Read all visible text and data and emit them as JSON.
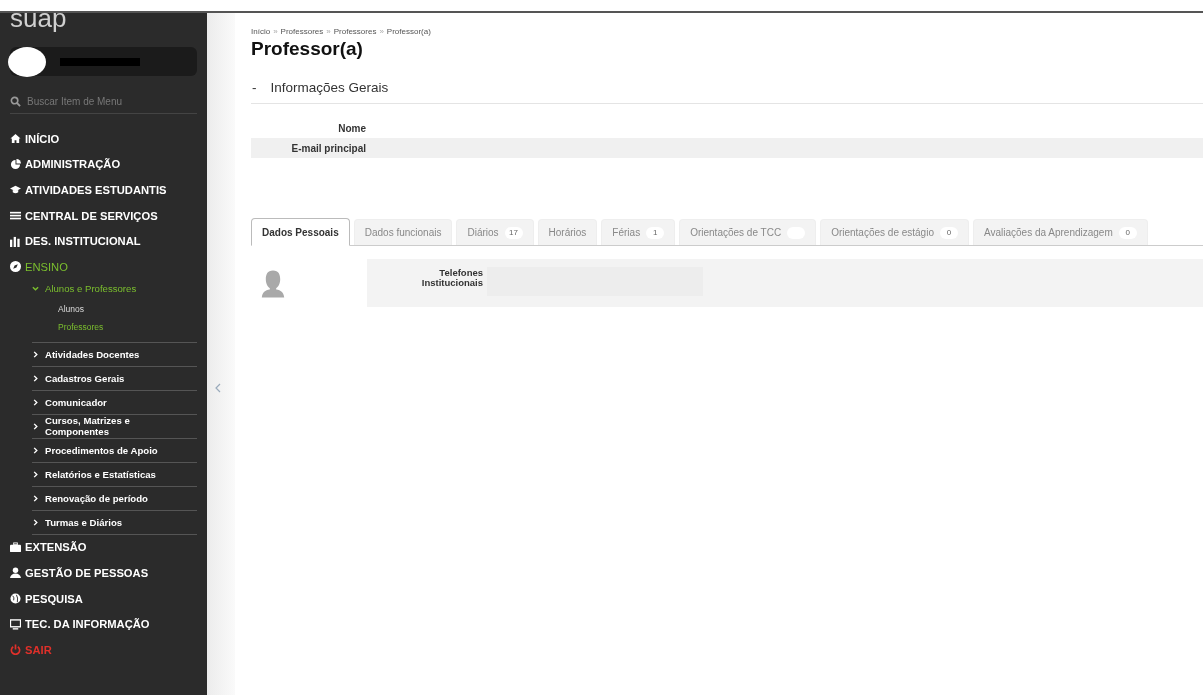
{
  "app": {
    "logo": "suap"
  },
  "sidebar": {
    "search": {
      "placeholder": "Buscar Item de Menu"
    },
    "items": [
      {
        "label": "INÍCIO",
        "kind": "menu",
        "selected": false
      },
      {
        "label": "ADMINISTRAÇÃO",
        "kind": "menu",
        "selected": false
      },
      {
        "label": "ATIVIDADES ESTUDANTIS",
        "kind": "menu",
        "selected": false
      },
      {
        "label": "CENTRAL DE SERVIÇOS",
        "kind": "menu",
        "selected": false
      },
      {
        "label": "DES. INSTITUCIONAL",
        "kind": "menu",
        "selected": false
      },
      {
        "label": "ENSINO",
        "kind": "menu",
        "selected": true,
        "children": [
          {
            "label": "Alunos e Professores",
            "expanded": true,
            "children": [
              {
                "label": "Alunos",
                "selected": false
              },
              {
                "label": "Professores",
                "selected": true
              }
            ]
          },
          {
            "label": "Atividades Docentes",
            "expanded": false
          },
          {
            "label": "Cadastros Gerais",
            "expanded": false
          },
          {
            "label": "Comunicador",
            "expanded": false
          },
          {
            "label": "Cursos, Matrizes e Componentes",
            "expanded": false
          },
          {
            "label": "Procedimentos de Apoio",
            "expanded": false
          },
          {
            "label": "Relatórios e Estatísticas",
            "expanded": false
          },
          {
            "label": "Renovação de período",
            "expanded": false
          },
          {
            "label": "Turmas e Diários",
            "expanded": false
          }
        ]
      },
      {
        "label": "EXTENSÃO",
        "kind": "menu",
        "selected": false
      },
      {
        "label": "GESTÃO DE PESSOAS",
        "kind": "menu",
        "selected": false
      },
      {
        "label": "PESQUISA",
        "kind": "menu",
        "selected": false
      },
      {
        "label": "TEC. DA INFORMAÇÃO",
        "kind": "menu",
        "selected": false
      },
      {
        "label": "SAIR",
        "kind": "logout",
        "selected": false
      }
    ]
  },
  "breadcrumb": [
    "Início",
    "Professores",
    "Professores",
    "Professor(a)"
  ],
  "breadcrumb_separator": "»",
  "title": "Professor(a)",
  "section": {
    "toggle": "-",
    "title": "Informações Gerais",
    "fields": [
      {
        "label": "Nome"
      },
      {
        "label": "E-mail principal"
      }
    ]
  },
  "tabs": [
    {
      "label": "Dados Pessoais",
      "selected": true,
      "badge": false
    },
    {
      "label": "Dados funcionais",
      "selected": false,
      "badge": false
    },
    {
      "label": "Diários",
      "selected": false,
      "badge": true,
      "count": "17"
    },
    {
      "label": "Horários",
      "selected": false,
      "badge": false
    },
    {
      "label": "Férias",
      "selected": false,
      "badge": true,
      "count": "1"
    },
    {
      "label": "Orientações de TCC",
      "selected": false,
      "badge": true
    },
    {
      "label": "Orientações de estágio",
      "selected": false,
      "badge": true,
      "count": "0"
    },
    {
      "label": "Avaliações da Aprendizagem",
      "selected": false,
      "badge": true,
      "count": "0"
    }
  ],
  "details": {
    "fields": [
      {
        "label": "Telefones Institucionais"
      }
    ]
  }
}
